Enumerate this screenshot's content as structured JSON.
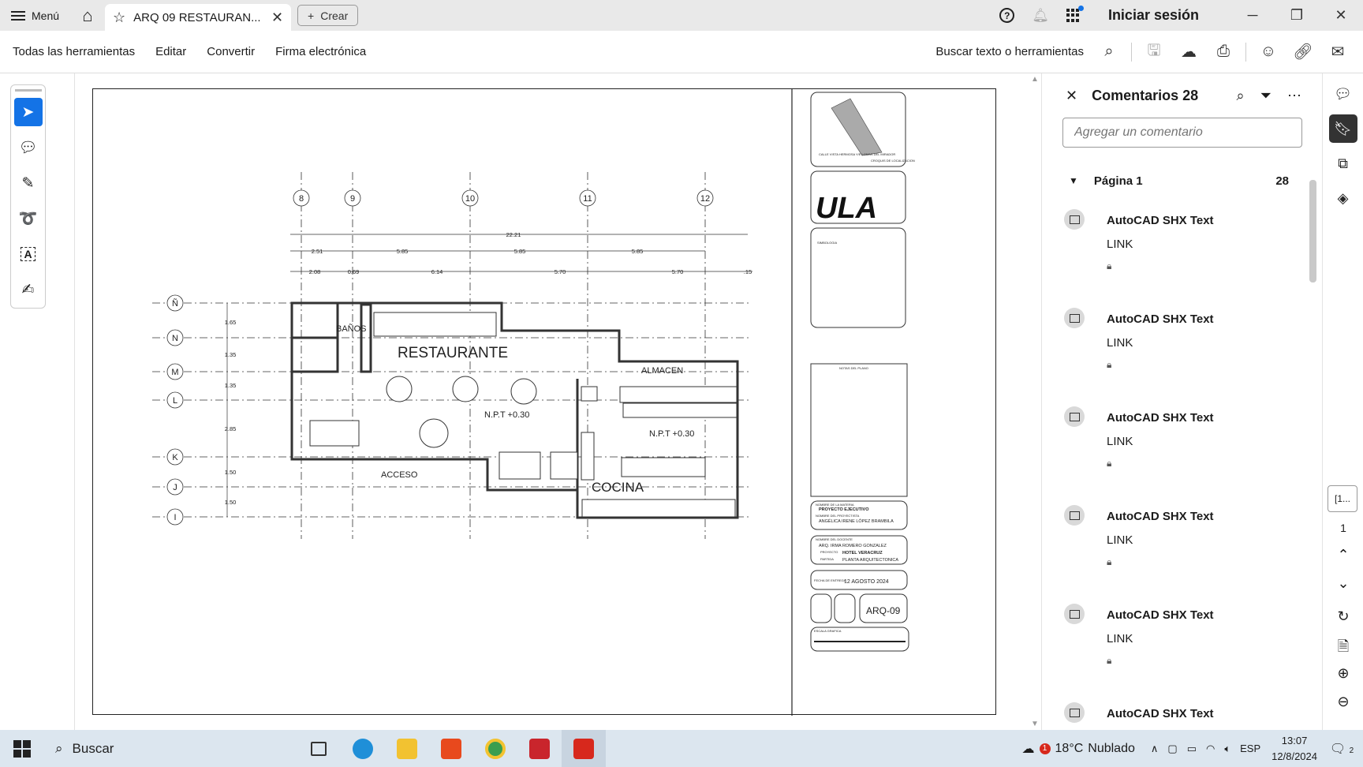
{
  "tabbar": {
    "menu_label": "Menú",
    "tab_title": "ARQ 09 RESTAURAN...",
    "create_label": "Crear",
    "signin_label": "Iniciar sesión"
  },
  "toolbar": {
    "items": [
      "Todas las herramientas",
      "Editar",
      "Convertir",
      "Firma electrónica"
    ],
    "search_label": "Buscar texto o herramientas"
  },
  "drawing": {
    "grid_cols": [
      "8",
      "9",
      "10",
      "11",
      "12"
    ],
    "grid_rows": [
      "Ñ",
      "N",
      "M",
      "L",
      "K",
      "J",
      "I"
    ],
    "total_dim": "22.21",
    "dims_row1": [
      "2.51",
      "5.85",
      "5.85",
      "5.85"
    ],
    "dims_row2": [
      "2.08",
      "0.69",
      "6.14",
      "5.70",
      "5.70",
      ".15"
    ],
    "row_dims": [
      "1.65",
      "1.35",
      "1.35",
      "2.85",
      "1.50",
      "1.50"
    ],
    "rooms": {
      "banos": "BAÑOS",
      "restaurante": "RESTAURANTE",
      "almacen": "ALMACEN",
      "acceso": "ACCESO",
      "cocina": "COCINA"
    },
    "level_1": "N.P.T +0.30",
    "level_2": "N.P.T +0.30"
  },
  "titleblock": {
    "loc_street": "CALLE VISTA HERMOSA Y/E LOMAS DEL MIRADOR",
    "loc_label": "CROQUIS DE LOCALIZACION",
    "logo": "ULA",
    "simbologia": "SIMBOLOGIA",
    "notas": "NOTAS DEL PLANO",
    "materia_label": "NOMBRE DE LA MATERIA",
    "materia": "PROYECTO EJECUTIVO",
    "proyectista_label": "NOMBRE DEL PROYECTISTA",
    "proyectista": "ANGÉLICA IRENE LÓPEZ BRAMBILA",
    "docente_label": "NOMBRE DEL DOCENTE",
    "docente": "ARQ. IRMA ROMERO GONZALEZ",
    "proyecto_label": "PROYECTO",
    "proyecto": "HOTEL VERACRUZ",
    "partida_label": "PARTIDA",
    "partida": "PLANTA ARQUITECTONICA",
    "fecha_label": "FECHA DE ENTREGA",
    "fecha": "12 AGOSTO 2024",
    "clave": "ARQ-09",
    "escala": "ESCALA GRAFICA"
  },
  "comments": {
    "title": "Comentarios 28",
    "placeholder": "Agregar un comentario",
    "page_label": "Página 1",
    "page_count": "28",
    "items": [
      {
        "author": "AutoCAD SHX Text",
        "body": "LINK"
      },
      {
        "author": "AutoCAD SHX Text",
        "body": "LINK"
      },
      {
        "author": "AutoCAD SHX Text",
        "body": "LINK"
      },
      {
        "author": "AutoCAD SHX Text",
        "body": "LINK"
      },
      {
        "author": "AutoCAD SHX Text",
        "body": "LINK"
      },
      {
        "author": "AutoCAD SHX Text",
        "body": ""
      }
    ]
  },
  "rail": {
    "page_box": "[1...",
    "page_total": "1"
  },
  "taskbar": {
    "search_label": "Buscar",
    "weather_temp": "18°C",
    "weather_text": "Nublado",
    "weather_badge": "1",
    "lang": "ESP",
    "time": "13:07",
    "date": "12/8/2024",
    "notif_count": "2"
  },
  "colors": {
    "accent": "#1473e6",
    "acrobat_red": "#d7281c",
    "taskbar_bg": "#dce6ef"
  }
}
